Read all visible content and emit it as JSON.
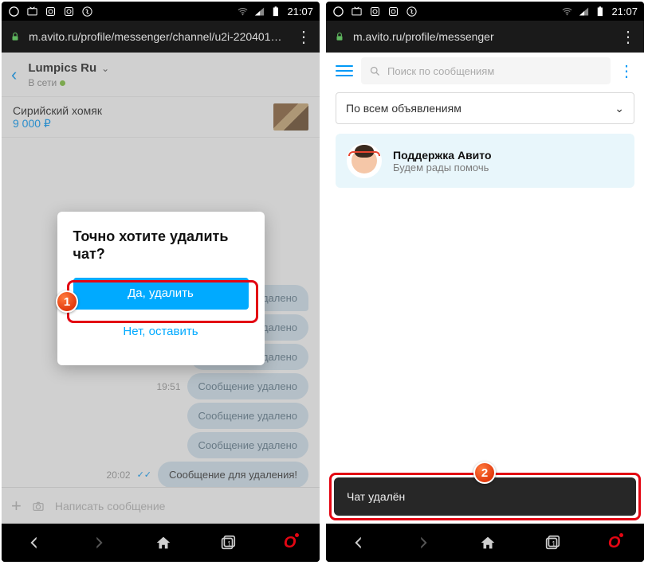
{
  "statusbar": {
    "time": "21:07"
  },
  "left": {
    "url": "m.avito.ru/profile/messenger/channel/u2i-220401…",
    "chat": {
      "title": "Lumpics Ru",
      "status": "В сети",
      "item_name": "Сирийский хомяк",
      "item_price": "9 000 ₽"
    },
    "messages": {
      "deleted": "Сообщение удалено",
      "last": "Сообщение для удаления!",
      "t1": "19:51",
      "t2": "20:02"
    },
    "composer_placeholder": "Написать сообщение",
    "modal": {
      "title": "Точно хотите удалить чат?",
      "confirm": "Да, удалить",
      "cancel": "Нет, оставить"
    }
  },
  "right": {
    "url": "m.avito.ru/profile/messenger",
    "search_placeholder": "Поиск по сообщениям",
    "filter": "По всем объявлениям",
    "support_title": "Поддержка Авито",
    "support_sub": "Будем рады помочь",
    "toast": "Чат удалён"
  },
  "steps": {
    "s1": "1",
    "s2": "2"
  }
}
